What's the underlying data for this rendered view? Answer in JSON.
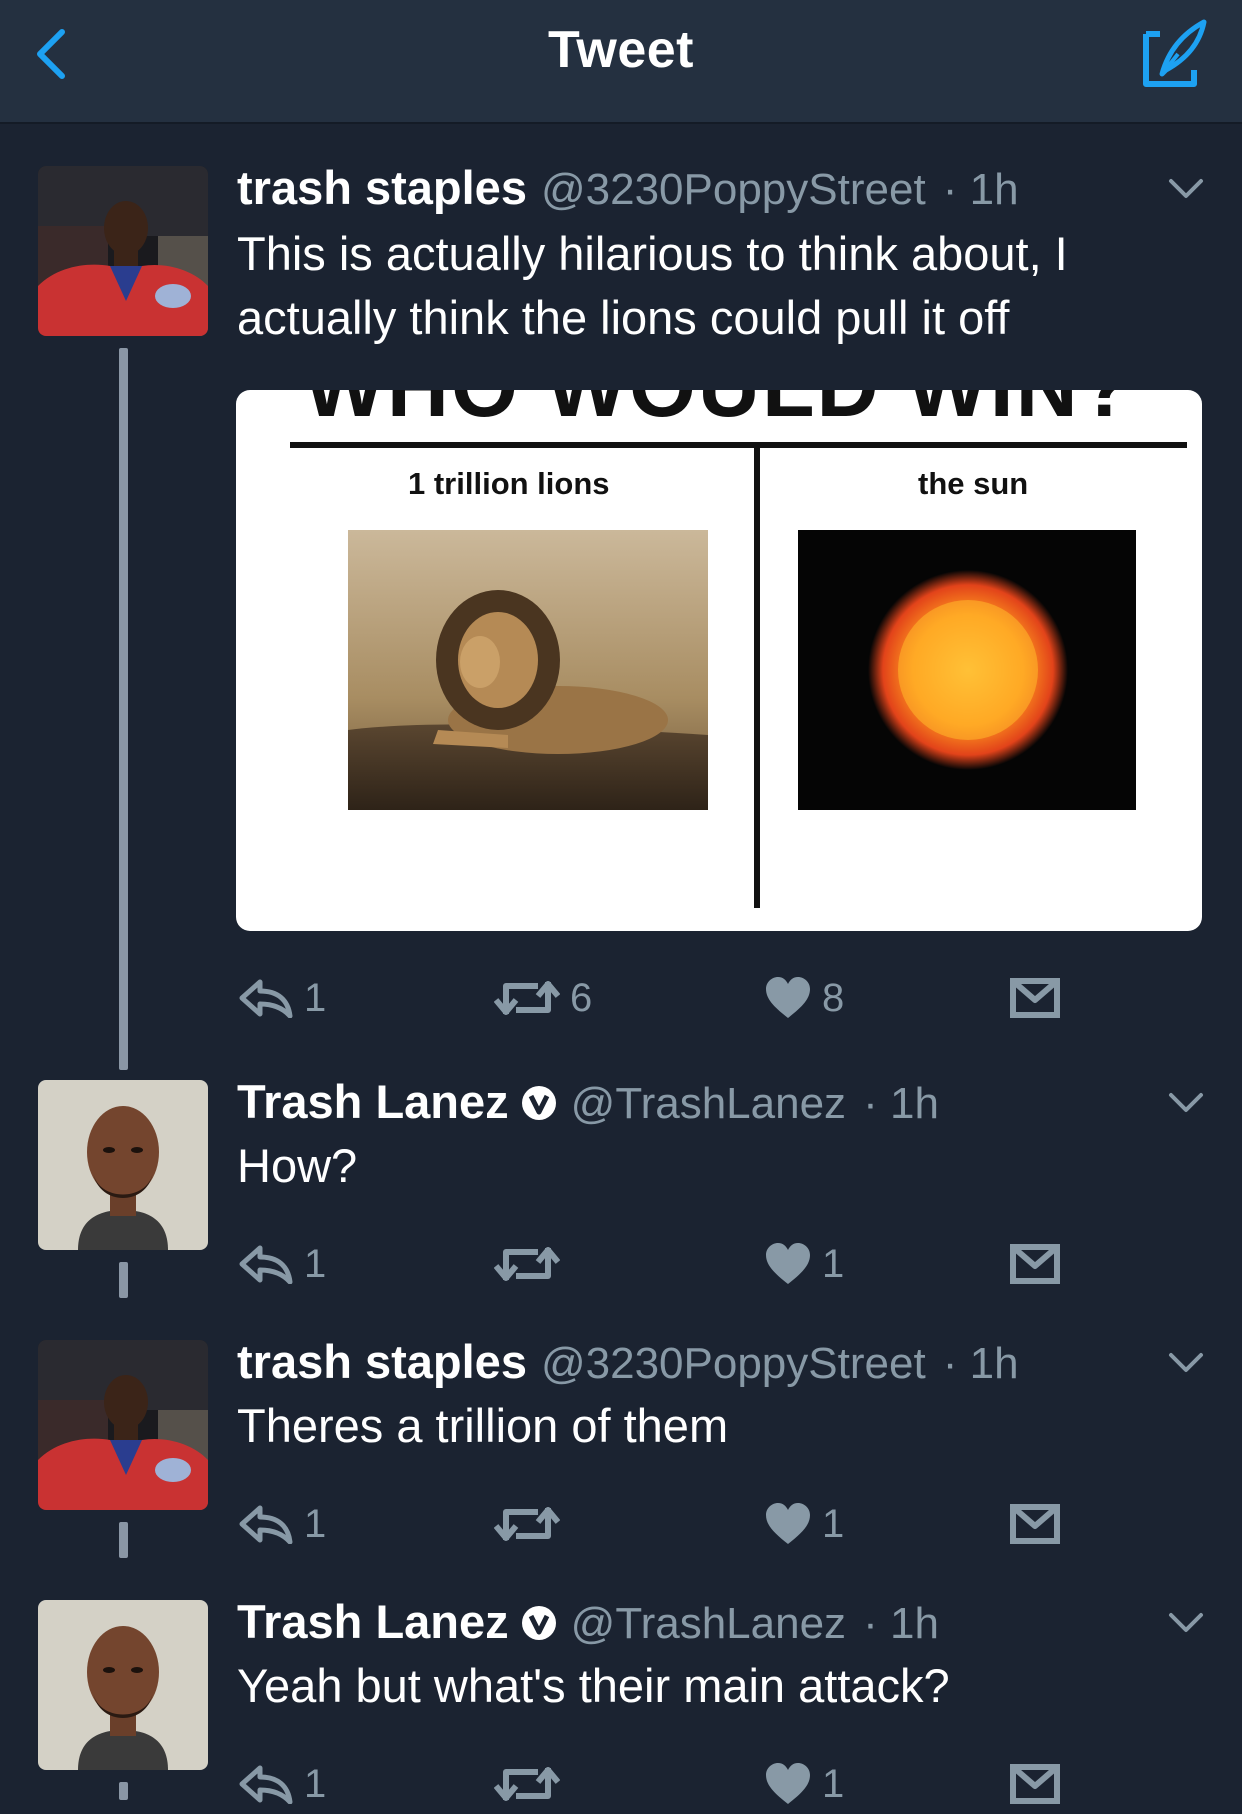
{
  "header": {
    "title": "Tweet",
    "back_icon": "chevron-left-icon",
    "compose_icon": "compose-tweet-icon",
    "accent_color": "#1da1f2"
  },
  "tweets": [
    {
      "name": "trash staples",
      "handle": "@3230PoppyStreet",
      "time": "· 1h",
      "verified": false,
      "text_lines": [
        "This is actually hilarious to think about, I",
        "actually think the lions could pull it off"
      ],
      "media": {
        "title": "WHO WOULD WIN?",
        "left_label": "1 trillion lions",
        "right_label": "the sun"
      },
      "replies": "1",
      "retweets": "6",
      "likes": "8"
    },
    {
      "name": "Trash Lanez",
      "handle": "@TrashLanez",
      "time": "· 1h",
      "verified": true,
      "text": "How?",
      "replies": "1",
      "retweets": "",
      "likes": "1"
    },
    {
      "name": "trash staples",
      "handle": "@3230PoppyStreet",
      "time": "· 1h",
      "verified": false,
      "text": "Theres a trillion of them",
      "replies": "1",
      "retweets": "",
      "likes": "1"
    },
    {
      "name": "Trash Lanez",
      "handle": "@TrashLanez",
      "time": "· 1h",
      "verified": true,
      "text": "Yeah but what's their main attack?",
      "replies": "1",
      "retweets": "",
      "likes": "1"
    }
  ],
  "icons": {
    "reply": "reply-icon",
    "retweet": "retweet-icon",
    "like": "heart-icon",
    "dm": "direct-message-icon",
    "caret": "chevron-down-icon",
    "verified": "verified-badge-icon"
  },
  "colors": {
    "background": "#1b2331",
    "header": "#243040",
    "muted_text": "#8899a6"
  }
}
